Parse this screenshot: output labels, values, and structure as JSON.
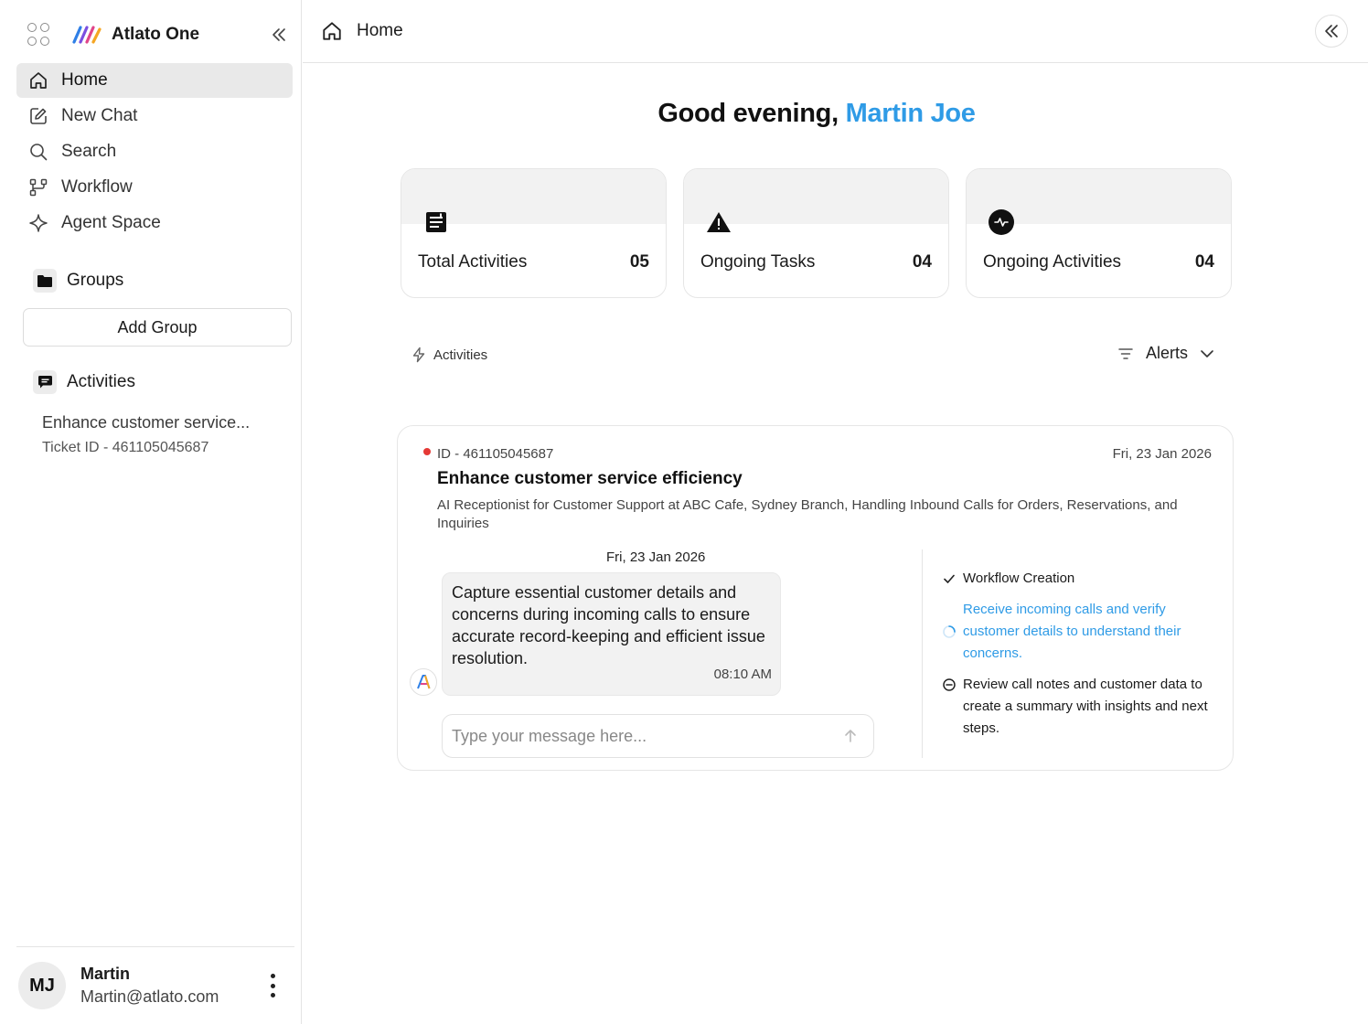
{
  "app": {
    "brand": "Atlato One"
  },
  "sidebar": {
    "nav": [
      {
        "label": "Home",
        "icon": "home-icon",
        "active": true
      },
      {
        "label": "New Chat",
        "icon": "edit-icon"
      },
      {
        "label": "Search",
        "icon": "search-icon"
      },
      {
        "label": "Workflow",
        "icon": "workflow-icon"
      },
      {
        "label": "Agent Space",
        "icon": "sparkle-icon"
      }
    ],
    "groups_label": "Groups",
    "add_group_label": "Add Group",
    "activities_label": "Activities",
    "activity_item": {
      "title": "Enhance customer service...",
      "subtitle": "Ticket ID - 461105045687"
    },
    "user": {
      "initials": "MJ",
      "name": "Martin",
      "email": "Martin@atlato.com"
    }
  },
  "topbar": {
    "breadcrumb": "Home"
  },
  "greeting": {
    "prefix": "Good evening, ",
    "name": "Martin Joe"
  },
  "stats": [
    {
      "label": "Total Activities",
      "value": "05",
      "icon": "document-list-icon"
    },
    {
      "label": "Ongoing Tasks",
      "value": "04",
      "icon": "warning-icon"
    },
    {
      "label": "Ongoing Activities",
      "value": "04",
      "icon": "pulse-icon"
    }
  ],
  "filter": {
    "left_label": "Activities",
    "right_label": "Alerts"
  },
  "card": {
    "id_text": "ID - 461105045687",
    "date": "Fri, 23 Jan 2026",
    "title": "Enhance customer service efficiency",
    "description": "AI Receptionist for Customer Support at ABC Cafe, Sydney Branch, Handling Inbound Calls for Orders, Reservations, and Inquiries",
    "chat_date": "Fri, 23 Jan 2026",
    "message": "Capture essential customer details and concerns during incoming calls to ensure accurate record-keeping and efficient issue resolution.",
    "message_time": "08:10 AM",
    "input_placeholder": "Type your message here...",
    "steps": [
      {
        "text": "Workflow Creation",
        "status": "done"
      },
      {
        "text": "Receive incoming calls and verify customer details to understand their concerns.",
        "status": "in-progress"
      },
      {
        "text": "Review call notes and customer data to create a summary with insights and next steps.",
        "status": "pending"
      }
    ]
  },
  "colors": {
    "accent": "#2f9be6",
    "alert_dot": "#e53935",
    "active_nav_bg": "#e9e9e9"
  }
}
